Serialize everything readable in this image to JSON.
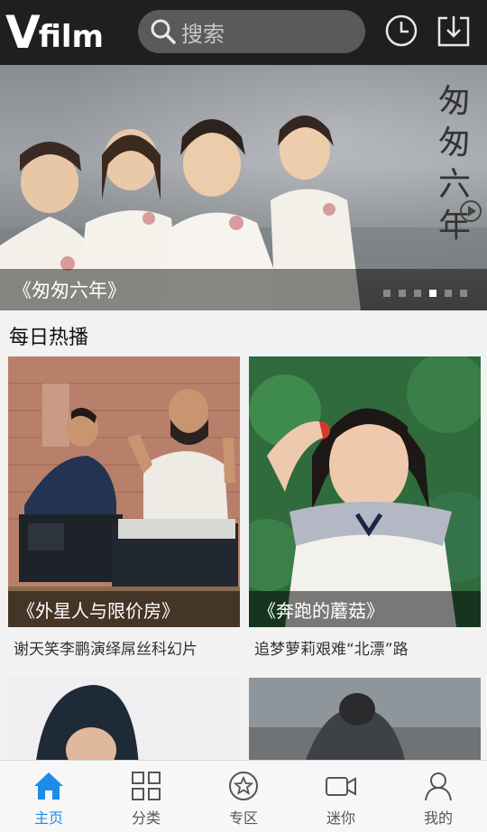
{
  "header": {
    "logo_v": "V",
    "logo_film": "film",
    "search_placeholder": "搜索",
    "icons": [
      "clock-icon",
      "download-icon"
    ]
  },
  "banner": {
    "caption": "《匆匆六年》",
    "vertical_title": [
      "匆",
      "匆",
      "六",
      "年"
    ],
    "dots_total": 6,
    "dots_active_index": 3
  },
  "section": {
    "title": "每日热播"
  },
  "cards": [
    {
      "caption": "《外星人与限价房》",
      "description": "谢天笑李鹏演绎屌丝科幻片"
    },
    {
      "caption": "《奔跑的蘑菇》",
      "description": "追梦萝莉艰难“北漂”路"
    }
  ],
  "nav": {
    "items": [
      {
        "label": "主页",
        "icon": "home-icon",
        "active": true
      },
      {
        "label": "分类",
        "icon": "grid-icon",
        "active": false
      },
      {
        "label": "专区",
        "icon": "star-circle-icon",
        "active": false
      },
      {
        "label": "迷你",
        "icon": "video-camera-icon",
        "active": false
      },
      {
        "label": "我的",
        "icon": "user-icon",
        "active": false
      }
    ]
  },
  "colors": {
    "accent": "#1e8be8",
    "header_bg": "#1f1f1f"
  }
}
